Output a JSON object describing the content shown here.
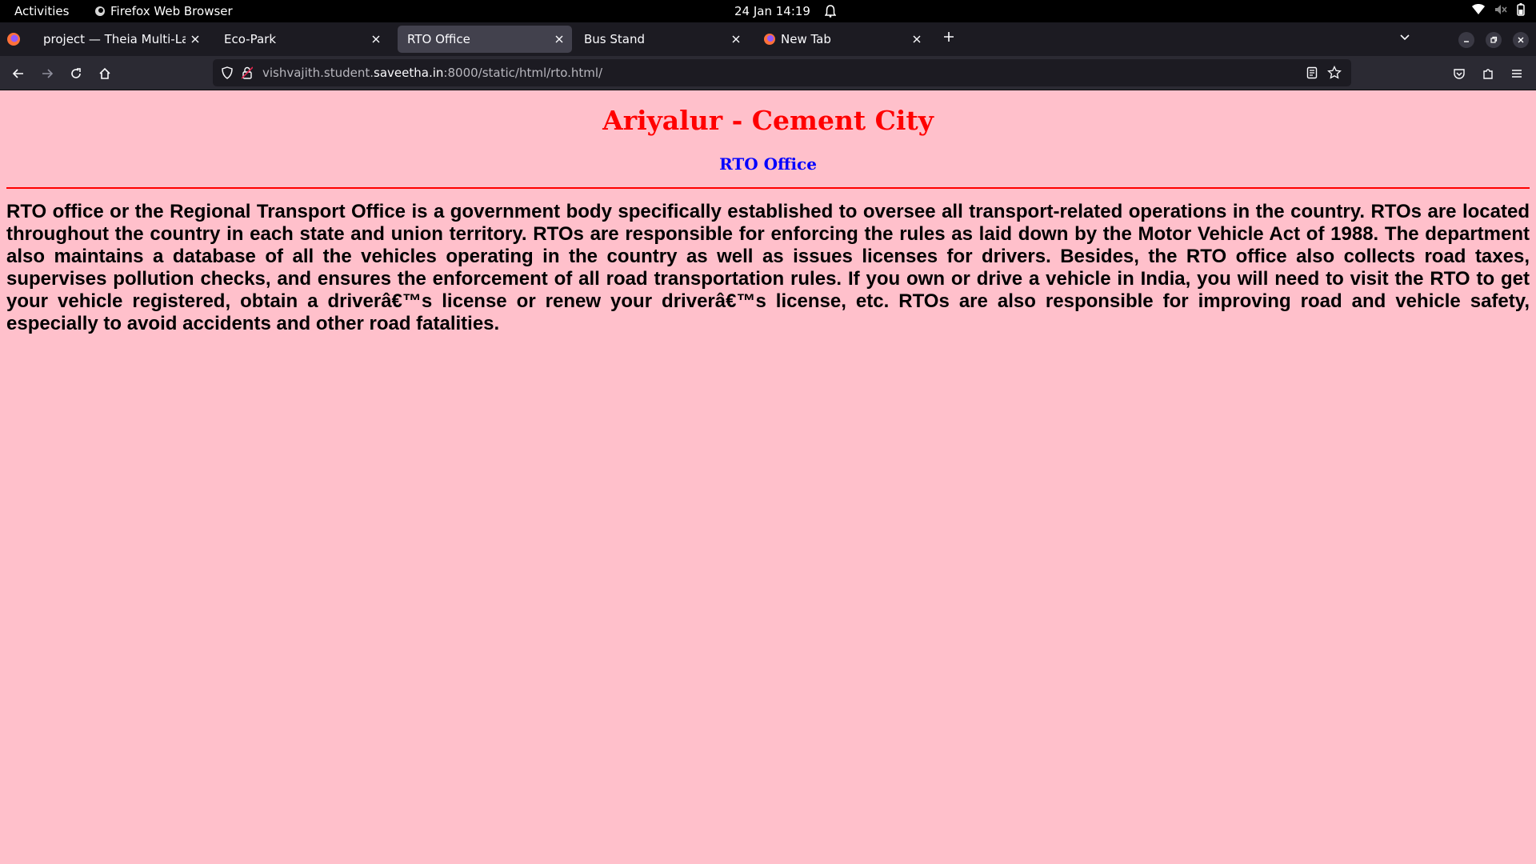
{
  "system_bar": {
    "activities": "Activities",
    "app_name": "Firefox Web Browser",
    "datetime": "24 Jan  14:19"
  },
  "browser": {
    "tabs": [
      {
        "label": "project — Theia Multi-Langu",
        "active": false
      },
      {
        "label": "Eco-Park",
        "active": false
      },
      {
        "label": "RTO Office",
        "active": true
      },
      {
        "label": "Bus Stand",
        "active": false
      },
      {
        "label": "New Tab",
        "active": false
      }
    ],
    "url": {
      "prefix": "vishvajith.student.",
      "domain": "saveetha.in",
      "suffix": ":8000/static/html/rto.html/"
    }
  },
  "page": {
    "background": "#FFC0CB",
    "title": "Ariyalur - Cement City",
    "title_color": "#ff0000",
    "subtitle": "RTO Office",
    "subtitle_color": "#0000ff",
    "divider_color": "#ff0000",
    "body": "RTO office or the Regional Transport Office is a government body specifically established to oversee all transport-related operations in the country. RTOs are located throughout the country in each state and union territory. RTOs are responsible for enforcing the rules as laid down by the Motor Vehicle Act of 1988. The department also maintains a database of all the vehicles operating in the country as well as issues licenses for drivers. Besides, the RTO office also collects road taxes, supervises pollution checks, and ensures the enforcement of all road transportation rules. If you own or drive a vehicle in India, you will need to visit the RTO to get your vehicle registered, obtain a driverâ€™s license or renew your driverâ€™s license, etc. RTOs are also responsible for improving road and vehicle safety, especially to avoid accidents and other road fatalities."
  }
}
